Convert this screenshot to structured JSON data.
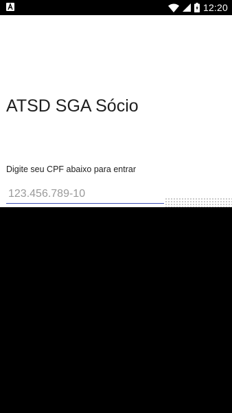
{
  "status_bar": {
    "time": "12:20",
    "left_icon": "notification-a-icon",
    "icons": [
      "wifi-icon",
      "cell-signal-icon",
      "battery-icon"
    ]
  },
  "main": {
    "title": "ATSD SGA Sócio",
    "prompt": "Digite seu CPF abaixo para entrar",
    "cpf_field": {
      "placeholder": "123.456.789-10",
      "value": ""
    }
  },
  "colors": {
    "accent": "#3f51b5",
    "background": "#ffffff",
    "status_bar": "#000000"
  }
}
